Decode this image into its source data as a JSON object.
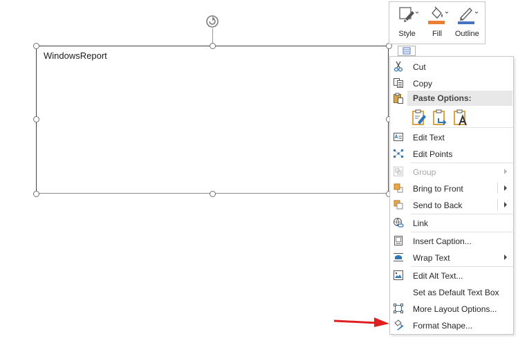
{
  "textbox": {
    "text": "WindowsReport"
  },
  "mini_toolbar": {
    "buttons": [
      {
        "label": "Style",
        "icon": "shape-style-icon"
      },
      {
        "label": "Fill",
        "icon": "paint-bucket-icon"
      },
      {
        "label": "Outline",
        "icon": "pen-outline-icon"
      }
    ]
  },
  "context_menu": {
    "cut": "Cut",
    "copy": "Copy",
    "paste_options": "Paste Options:",
    "edit_text": "Edit Text",
    "edit_points": "Edit Points",
    "group": "Group",
    "bring_to_front": "Bring to Front",
    "send_to_back": "Send to Back",
    "link": "Link",
    "insert_caption": "Insert Caption...",
    "wrap_text": "Wrap Text",
    "edit_alt_text": "Edit Alt Text...",
    "set_default_text_box": "Set as Default Text Box",
    "more_layout_options": "More Layout Options...",
    "format_shape": "Format Shape..."
  },
  "colors": {
    "fill_accent": "#ed7d31",
    "outline_accent": "#4472c4",
    "arrow_red": "#e02020"
  }
}
